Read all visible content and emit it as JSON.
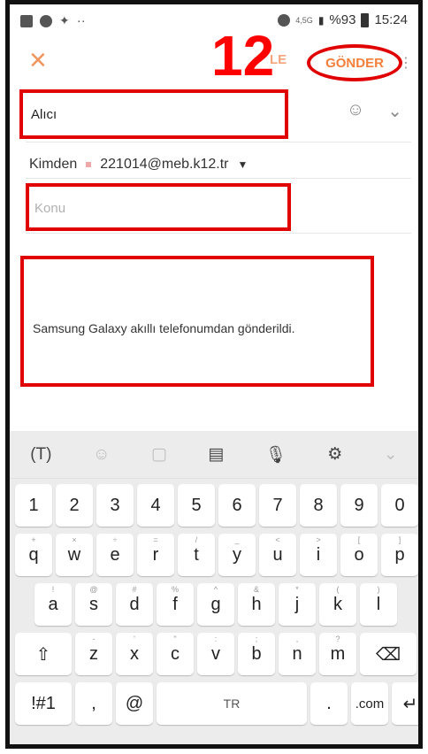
{
  "status": {
    "network": "4,5G",
    "battery": "%93",
    "time": "15:24"
  },
  "header": {
    "close_glyph": "×",
    "step_number": "12",
    "partial_label": "LE",
    "send_label": "GÖNDER"
  },
  "fields": {
    "to_label": "Alıcı",
    "from_label": "Kimden",
    "from_address": "221014@meb.k12.tr",
    "subject_placeholder": "Konu"
  },
  "body": {
    "signature": "Samsung Galaxy akıllı telefonumdan gönderildi."
  },
  "keyboard": {
    "toolbar": [
      "(T)",
      "☺",
      "▢",
      "▤",
      "🎙",
      "⚙",
      "⌄"
    ],
    "row_numbers": [
      "1",
      "2",
      "3",
      "4",
      "5",
      "6",
      "7",
      "8",
      "9",
      "0"
    ],
    "row_1": [
      {
        "k": "q",
        "s": "+"
      },
      {
        "k": "w",
        "s": "×"
      },
      {
        "k": "e",
        "s": "÷"
      },
      {
        "k": "r",
        "s": "="
      },
      {
        "k": "t",
        "s": "/"
      },
      {
        "k": "y",
        "s": "_"
      },
      {
        "k": "u",
        "s": "<"
      },
      {
        "k": "i",
        "s": ">"
      },
      {
        "k": "o",
        "s": "["
      },
      {
        "k": "p",
        "s": "]"
      }
    ],
    "row_2": [
      {
        "k": "a",
        "s": "!"
      },
      {
        "k": "s",
        "s": "@"
      },
      {
        "k": "d",
        "s": "#"
      },
      {
        "k": "f",
        "s": "%"
      },
      {
        "k": "g",
        "s": "^"
      },
      {
        "k": "h",
        "s": "&"
      },
      {
        "k": "j",
        "s": "*"
      },
      {
        "k": "k",
        "s": "("
      },
      {
        "k": "l",
        "s": ")"
      }
    ],
    "row_3": [
      {
        "k": "z",
        "s": "-"
      },
      {
        "k": "x",
        "s": "'"
      },
      {
        "k": "c",
        "s": "\""
      },
      {
        "k": "v",
        "s": ":"
      },
      {
        "k": "b",
        "s": ";"
      },
      {
        "k": "n",
        "s": ","
      },
      {
        "k": "m",
        "s": "?"
      }
    ],
    "bottom": {
      "symbols": "!#1",
      "comma": ",",
      "at": "@",
      "space": "TR",
      "period": ".",
      "com": ".com"
    }
  }
}
